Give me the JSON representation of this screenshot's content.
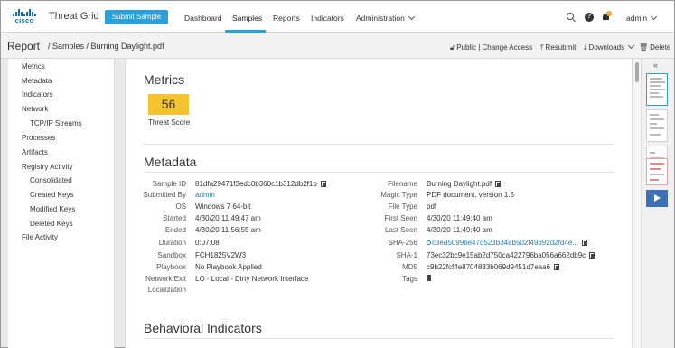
{
  "nav": {
    "brand": "cisco",
    "product": "Threat Grid",
    "submit_label": "Submit Sample",
    "items": [
      "Dashboard",
      "Samples",
      "Reports",
      "Indicators",
      "Administration"
    ],
    "user": "admin",
    "notification_count": "3",
    "accent_color": "#2a9fd8"
  },
  "breadcrumb": {
    "title": "Report",
    "path": "/ Samples / Burning Daylight.pdf",
    "actions": {
      "access": "Public | Change Access",
      "resubmit": "Resubmit",
      "downloads": "Downloads",
      "delete": "Delete"
    }
  },
  "sidebar": {
    "items": [
      "Metrics",
      "Metadata",
      "Indicators",
      "Network",
      "TCP/IP Streams",
      "Processes",
      "Artifacts",
      "Registry Activity",
      "Consolidated",
      "Created Keys",
      "Modified Keys",
      "Deleted Keys",
      "File Activity"
    ]
  },
  "metrics": {
    "heading": "Metrics",
    "threat_score": "56",
    "threat_label": "Threat Score",
    "threat_color": "#f4c430"
  },
  "metadata": {
    "heading": "Metadata",
    "left": [
      {
        "label": "Sample ID",
        "value": "81dfa29471f3edc0b360c1b312db2f1b"
      },
      {
        "label": "Submitted By",
        "value": "admin"
      },
      {
        "label": "OS",
        "value": "Windows 7 64-bit"
      },
      {
        "label": "Started",
        "value": "4/30/20 11:49:47 am"
      },
      {
        "label": "Ended",
        "value": "4/30/20 11:56:55 am"
      },
      {
        "label": "Duration",
        "value": "0:07:08"
      },
      {
        "label": "Sandbox",
        "value": "FCH1825V2W3"
      },
      {
        "label": "Playbook",
        "value": "No Playbook Applied"
      },
      {
        "label": "Network Exit",
        "label2": "Localization",
        "value": "LO - Local - Dirty Network Interface"
      }
    ],
    "right": [
      {
        "label": "Filename",
        "value": "Burning Daylight.pdf"
      },
      {
        "label": "Magic Type",
        "value": "PDF document, version 1.5"
      },
      {
        "label": "File Type",
        "value": "pdf"
      },
      {
        "label": "First Seen",
        "value": "4/30/20 11:49:40 am"
      },
      {
        "label": "Last Seen",
        "value": "4/30/20 11:49:40 am"
      },
      {
        "label": "SHA-256",
        "value": "c3ed5099be47d523b34ab502f49392d2fd4e..."
      },
      {
        "label": "SHA-1",
        "value": "73ec32bc9e15ab2d750ca422796ba056a662db9c"
      },
      {
        "label": "MD5",
        "value": "c9b22fcf4e8704833b069d9451d7eaa6"
      },
      {
        "label": "Tags",
        "value": ""
      }
    ]
  },
  "behavioral": {
    "heading": "Behavioral Indicators"
  }
}
